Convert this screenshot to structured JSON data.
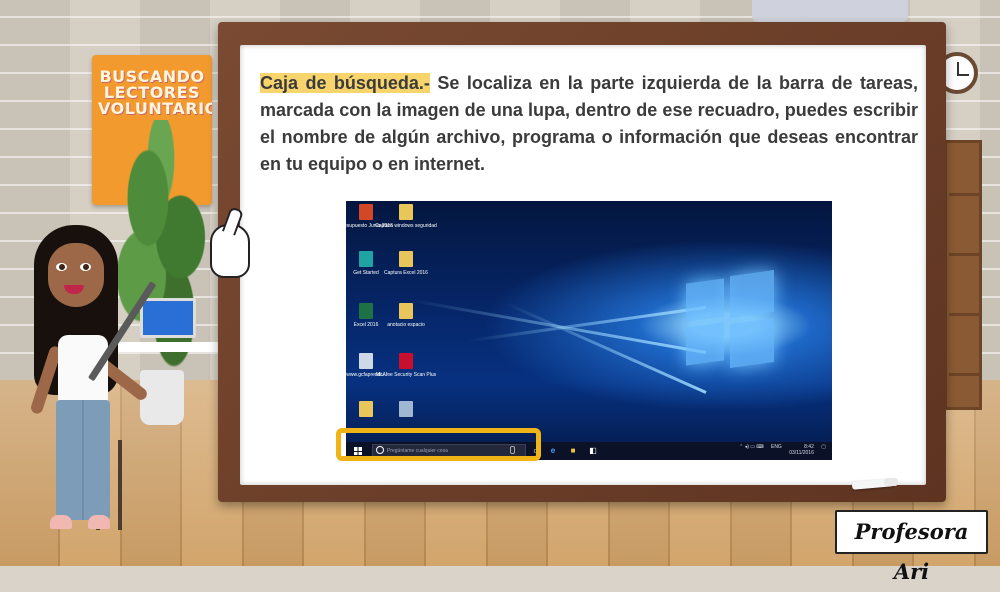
{
  "slide": {
    "heading": "Caja de búsqueda.-",
    "body": " Se localiza en la parte izquierda de la barra de tareas, marcada con la imagen de una lupa, dentro de ese recuadro, puedes escribir el nombre de algún archivo, programa o información que deseas encontrar en tu equipo o en internet.",
    "highlight_color": "#f7d46c"
  },
  "poster": {
    "text": "BUSCANDO LECTORES VOLUNTARIOS"
  },
  "desktop": {
    "icons": [
      {
        "label": "Presupuesto Junio 2016",
        "icon": "powerpoint-icon",
        "color": "#d24726"
      },
      {
        "label": "Captura windows seguridad",
        "icon": "folder-icon",
        "color": "#e8c65a"
      },
      {
        "label": "Get Started",
        "icon": "lightbulb-icon",
        "color": "#1fa3a3"
      },
      {
        "label": "Captura Excel 2016",
        "icon": "folder-icon",
        "color": "#e8c65a"
      },
      {
        "label": "Excel 2016",
        "icon": "excel-icon",
        "color": "#1e7145"
      },
      {
        "label": "anotacio espacio",
        "icon": "folder-icon",
        "color": "#e8c65a"
      },
      {
        "label": "www.gcfaprendi...",
        "icon": "file-icon",
        "color": "#cfd8e6"
      },
      {
        "label": "McAfee Security Scan Plus",
        "icon": "mcafee-icon",
        "color": "#c8102e"
      },
      {
        "label": "",
        "icon": "folder-icon",
        "color": "#e8c65a"
      },
      {
        "label": "",
        "icon": "recycle-bin-icon",
        "color": "#9fb7d3"
      }
    ],
    "taskbar": {
      "search_placeholder": "Pregúntame cualquier cosa",
      "tray_lang": "ENG",
      "tray_time": "8:42",
      "tray_date": "03/11/2016"
    }
  },
  "signature": "Profesora Ari",
  "colors": {
    "frame": "#6b3d27",
    "highlight_box": "#f1b417",
    "wallpaper": "#063080"
  }
}
